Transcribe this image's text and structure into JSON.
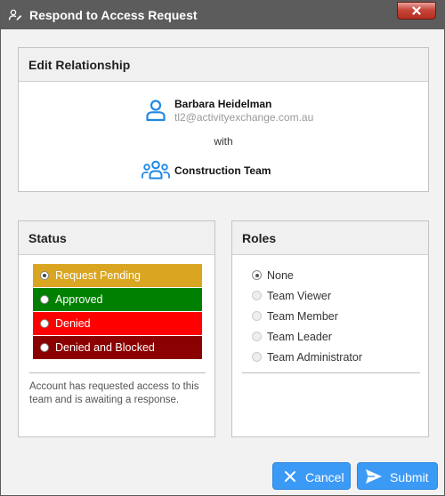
{
  "window": {
    "title": "Respond to Access Request",
    "close_icon": "close-icon"
  },
  "edit_relationship": {
    "header": "Edit Relationship",
    "user_name": "Barbara Heidelman",
    "user_email": "tl2@activityexchange.com.au",
    "with_label": "with",
    "team_name": "Construction Team"
  },
  "status": {
    "header": "Status",
    "options": [
      {
        "label": "Request Pending",
        "color": "#DAA520",
        "selected": true
      },
      {
        "label": "Approved",
        "color": "#008000",
        "selected": false
      },
      {
        "label": "Denied",
        "color": "#FF0000",
        "selected": false
      },
      {
        "label": "Denied and Blocked",
        "color": "#8B0000",
        "selected": false
      }
    ],
    "description": "Account has requested access to this team and is awaiting a response."
  },
  "roles": {
    "header": "Roles",
    "options": [
      {
        "label": "None",
        "selected": true
      },
      {
        "label": "Team Viewer",
        "selected": false
      },
      {
        "label": "Team Member",
        "selected": false
      },
      {
        "label": "Team Leader",
        "selected": false
      },
      {
        "label": "Team Administrator",
        "selected": false
      }
    ]
  },
  "buttons": {
    "cancel": "Cancel",
    "submit": "Submit"
  },
  "colors": {
    "accent": "#3C9AF7",
    "icon_blue": "#1E88E5",
    "titlebar": "#5C5C5C"
  }
}
